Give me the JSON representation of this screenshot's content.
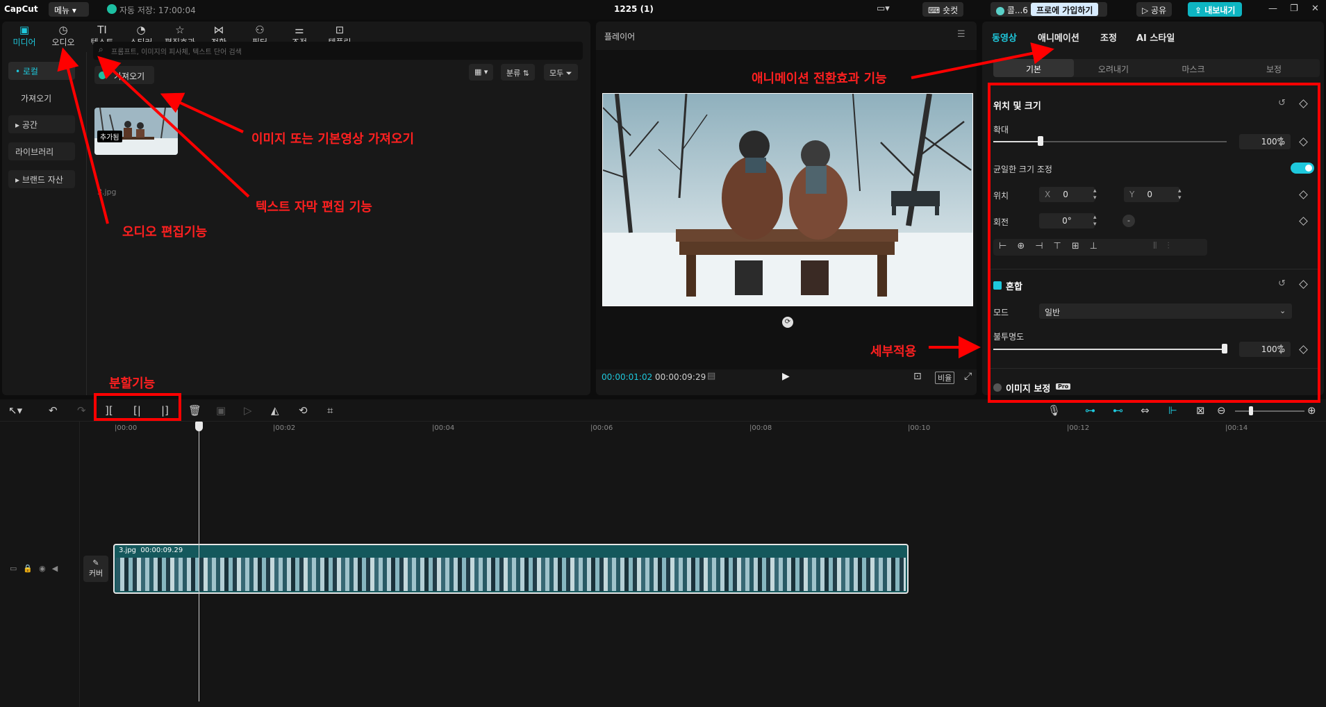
{
  "titlebar": {
    "logo": "CapCut",
    "menu": "메뉴",
    "autosave": "자동 저장: 17:00:04",
    "project_title": "1225 (1)",
    "shortcut": "숏컷",
    "user": "콜...6",
    "pro": "프로에 가입하기",
    "share": "공유",
    "export": "내보내기"
  },
  "media_tabs": [
    {
      "label": "미디어",
      "icon": "▣"
    },
    {
      "label": "오디오",
      "icon": "◷"
    },
    {
      "label": "텍스트",
      "icon": "TI"
    },
    {
      "label": "스티커",
      "icon": "◔"
    },
    {
      "label": "편집효과",
      "icon": "☆"
    },
    {
      "label": "전환",
      "icon": "⋈"
    },
    {
      "label": "필터",
      "icon": "⚇"
    },
    {
      "label": "조정",
      "icon": "⚌"
    },
    {
      "label": "템플릿",
      "icon": "⊡"
    }
  ],
  "media_sidebar": {
    "local": "• 로컬",
    "import": "가져오기",
    "space": "▸ 공간",
    "library": "라이브러리",
    "brand": "▸ 브랜드 자산"
  },
  "media": {
    "search_placeholder": "프롬프트, 이미지의 피사체, 텍스트 단어 검색",
    "import_label": "가져오기",
    "sort_label": "분류",
    "all_filter": "모두",
    "section_label": "모두",
    "thumb_badge": "추가됨",
    "thumb_name": "3.jpg"
  },
  "player": {
    "title": "플레이어",
    "current_time": "00:00:01:02",
    "total_time": "00:00:09:29",
    "ratio": "비율"
  },
  "props": {
    "tabs": [
      "동영상",
      "애니메이션",
      "조정",
      "AI 스타일"
    ],
    "subtabs": [
      "기본",
      "오려내기",
      "마스크",
      "보정"
    ],
    "pos_size": "위치 및 크기",
    "scale": "확대",
    "scale_value": "100%",
    "uniform_scale": "균일한 크기 조정",
    "position": "위치",
    "x_label": "X",
    "x_value": "0",
    "y_label": "Y",
    "y_value": "0",
    "rotation": "회전",
    "rotation_value": "0°",
    "blend": "혼합",
    "mode": "모드",
    "mode_value": "일반",
    "opacity": "불투명도",
    "opacity_value": "100%",
    "image_correction": "이미지 보정",
    "pro_badge": "Pro"
  },
  "timeline": {
    "ruler": [
      "|00:00",
      "|00:02",
      "|00:04",
      "|00:06",
      "|00:08",
      "|00:10",
      "|00:12",
      "|00:14"
    ],
    "cover": "커버",
    "clip_name": "3.jpg",
    "clip_duration": "00:00:09.29"
  },
  "annotations": {
    "animation": "애니메이션 전환효과 기능",
    "import": "이미지 또는 기본영상 가져오기",
    "text": "텍스트 자막 편집 기능",
    "audio": "오디오 편집기능",
    "split": "분할기능",
    "detail": "세부적용"
  },
  "colors": {
    "accent": "#1ec8dc",
    "annotation": "#ff0000",
    "clip": "#14585c"
  }
}
